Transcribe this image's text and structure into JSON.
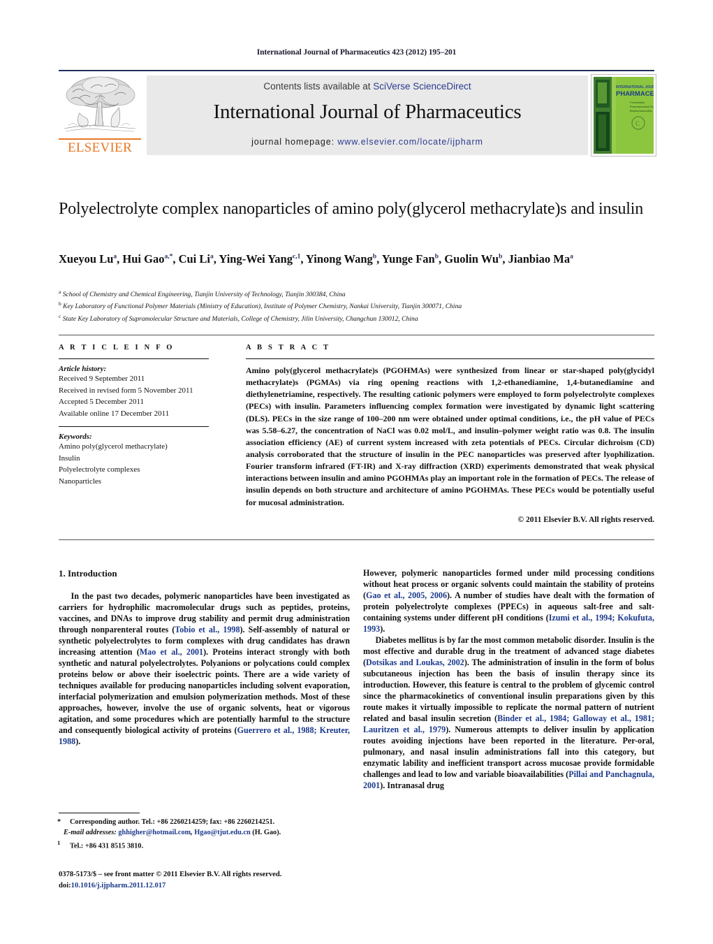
{
  "running_head": "International Journal of Pharmaceutics 423 (2012) 195–201",
  "masthead": {
    "contents_prefix": "Contents lists available at ",
    "contents_link": "SciVerse ScienceDirect",
    "journal_title": "International Journal of Pharmaceutics",
    "homepage_prefix": "journal homepage: ",
    "homepage_url": "www.elsevier.com/locate/ijpharm",
    "publisher_logo_text": "ELSEVIER",
    "publisher_logo_color": "#e87722",
    "link_color": "#2b3a8f",
    "cover": {
      "line1": "INTERNATIONAL JOURNAL OF",
      "line2": "PHARMACEUTICS",
      "line3": "Formulation",
      "line4": "Pharmaceutical Technology",
      "line5": "Biopharmaceutics",
      "accent_color": "#8cc63f"
    }
  },
  "title": "Polyelectrolyte complex nanoparticles of amino poly(glycerol methacrylate)s and insulin",
  "authors": [
    {
      "name": "Xueyou Lu",
      "sup": "a"
    },
    {
      "name": "Hui Gao",
      "sup": "a,*"
    },
    {
      "name": "Cui Li",
      "sup": "a"
    },
    {
      "name": "Ying-Wei Yang",
      "sup": "c,1"
    },
    {
      "name": "Yinong Wang",
      "sup": "b"
    },
    {
      "name": "Yunge Fan",
      "sup": "b"
    },
    {
      "name": "Guolin Wu",
      "sup": "b"
    },
    {
      "name": "Jianbiao Ma",
      "sup": "a"
    }
  ],
  "affiliations": [
    {
      "mark": "a",
      "text": "School of Chemistry and Chemical Engineering, Tianjin University of Technology, Tianjin 300384, China"
    },
    {
      "mark": "b",
      "text": "Key Laboratory of Functional Polymer Materials (Ministry of Education), Institute of Polymer Chemistry, Nankai University, Tianjin 300071, China"
    },
    {
      "mark": "c",
      "text": "State Key Laboratory of Supramolecular Structure and Materials, College of Chemistry, Jilin University, Changchun 130012, China"
    }
  ],
  "article_info": {
    "label": "A R T I C L E    I N F O",
    "history_label": "Article history:",
    "history": [
      "Received 9 September 2011",
      "Received in revised form 5 November 2011",
      "Accepted 5 December 2011",
      "Available online 17 December 2011"
    ],
    "keywords_label": "Keywords:",
    "keywords": [
      "Amino poly(glycerol methacrylate)",
      "Insulin",
      "Polyelectrolyte complexes",
      "Nanoparticles"
    ]
  },
  "abstract": {
    "label": "A B S T R A C T",
    "text": "Amino poly(glycerol methacrylate)s (PGOHMAs) were synthesized from linear or star-shaped poly(glycidyl methacrylate)s (PGMAs) via ring opening reactions with 1,2-ethanediamine, 1,4-butanediamine and diethylenetriamine, respectively. The resulting cationic polymers were employed to form polyelectrolyte complexes (PECs) with insulin. Parameters influencing complex formation were investigated by dynamic light scattering (DLS). PECs in the size range of 100–200 nm were obtained under optimal conditions, i.e., the pH value of PECs was 5.58–6.27, the concentration of NaCl was 0.02 mol/L, and insulin–polymer weight ratio was 0.8. The insulin association efficiency (AE) of current system increased with zeta potentials of PECs. Circular dichroism (CD) analysis corroborated that the structure of insulin in the PEC nanoparticles was preserved after lyophilization. Fourier transform infrared (FT-IR) and X-ray diffraction (XRD) experiments demonstrated that weak physical interactions between insulin and amino PGOHMAs play an important role in the formation of PECs. The release of insulin depends on both structure and architecture of amino PGOHMAs. These PECs would be potentially useful for mucosal administration.",
    "copyright": "© 2011 Elsevier B.V. All rights reserved."
  },
  "body": {
    "section_number": "1.",
    "section_title": "Introduction",
    "left_paragraph_1_parts": [
      {
        "t": "In the past two decades, polymeric nanoparticles have been investigated as carriers for hydrophilic macromolecular drugs such as peptides, proteins, vaccines, and DNAs to improve drug stability and permit drug administration through nonparenteral routes (",
        "ref": false
      },
      {
        "t": "Tobio et al., 1998",
        "ref": true
      },
      {
        "t": "). Self-assembly of natural or synthetic polyelectrolytes to form complexes with drug candidates has drawn increasing attention (",
        "ref": false
      },
      {
        "t": "Mao et al., 2001",
        "ref": true
      },
      {
        "t": "). Proteins interact strongly with both synthetic and natural polyelectrolytes. Polyanions or polycations could complex proteins below or above their isoelectric points. There are a wide variety of techniques available for producing nanoparticles including solvent evaporation, interfacial polymerization and emulsion polymerization methods. Most of these approaches, however, involve the use of organic solvents, heat or vigorous agitation, and some procedures which are potentially harmful to the structure and consequently biological activity of proteins (",
        "ref": false
      },
      {
        "t": "Guerrero et al., 1988; Kreuter, 1988",
        "ref": true
      },
      {
        "t": ").",
        "ref": false
      }
    ],
    "right_paragraph_1_parts": [
      {
        "t": "However, polymeric nanoparticles formed under mild processing conditions without heat process or organic solvents could maintain the stability of proteins (",
        "ref": false
      },
      {
        "t": "Gao et al., 2005, 2006",
        "ref": true
      },
      {
        "t": "). A number of studies have dealt with the formation of protein polyelectrolyte complexes (PPECs) in aqueous salt-free and salt-containing systems under different pH conditions (",
        "ref": false
      },
      {
        "t": "Izumi et al., 1994; Kokufuta, 1993",
        "ref": true
      },
      {
        "t": ").",
        "ref": false
      }
    ],
    "right_paragraph_2_parts": [
      {
        "t": "Diabetes mellitus is by far the most common metabolic disorder. Insulin is the most effective and durable drug in the treatment of advanced stage diabetes (",
        "ref": false
      },
      {
        "t": "Dotsikas and Loukas, 2002",
        "ref": true
      },
      {
        "t": "). The administration of insulin in the form of bolus subcutaneous injection has been the basis of insulin therapy since its introduction. However, this feature is central to the problem of glycemic control since the pharmacokinetics of conventional insulin preparations given by this route makes it virtually impossible to replicate the normal pattern of nutrient related and basal insulin secretion (",
        "ref": false
      },
      {
        "t": "Binder et al., 1984; Galloway et al., 1981; Lauritzen et al., 1979",
        "ref": true
      },
      {
        "t": "). Numerous attempts to deliver insulin by application routes avoiding injections have been reported in the literature. Per-oral, pulmonary, and nasal insulin administrations fall into this category, but enzymatic lability and inefficient transport across mucosae provide formidable challenges and lead to low and variable bioavailabilities (",
        "ref": false
      },
      {
        "t": "Pillai and Panchagnula, 2001",
        "ref": true
      },
      {
        "t": "). Intranasal drug",
        "ref": false
      }
    ]
  },
  "footnotes": {
    "corresponding": "Corresponding author. Tel.: +86 2260214259; fax: +86 2260214251.",
    "email_label": "E-mail addresses:",
    "email_1": "ghhigher@hotmail.com",
    "email_2": "Hgao@tjut.edu.cn",
    "email_suffix": "(H. Gao).",
    "tel_note": "Tel.: +86 431 8515 3810.",
    "corresponding_mark": "*",
    "tel_mark": "1"
  },
  "imprint": {
    "line1": "0378-5173/$ – see front matter © 2011 Elsevier B.V. All rights reserved.",
    "doi_prefix": "doi:",
    "doi": "10.1016/j.ijpharm.2011.12.017"
  }
}
